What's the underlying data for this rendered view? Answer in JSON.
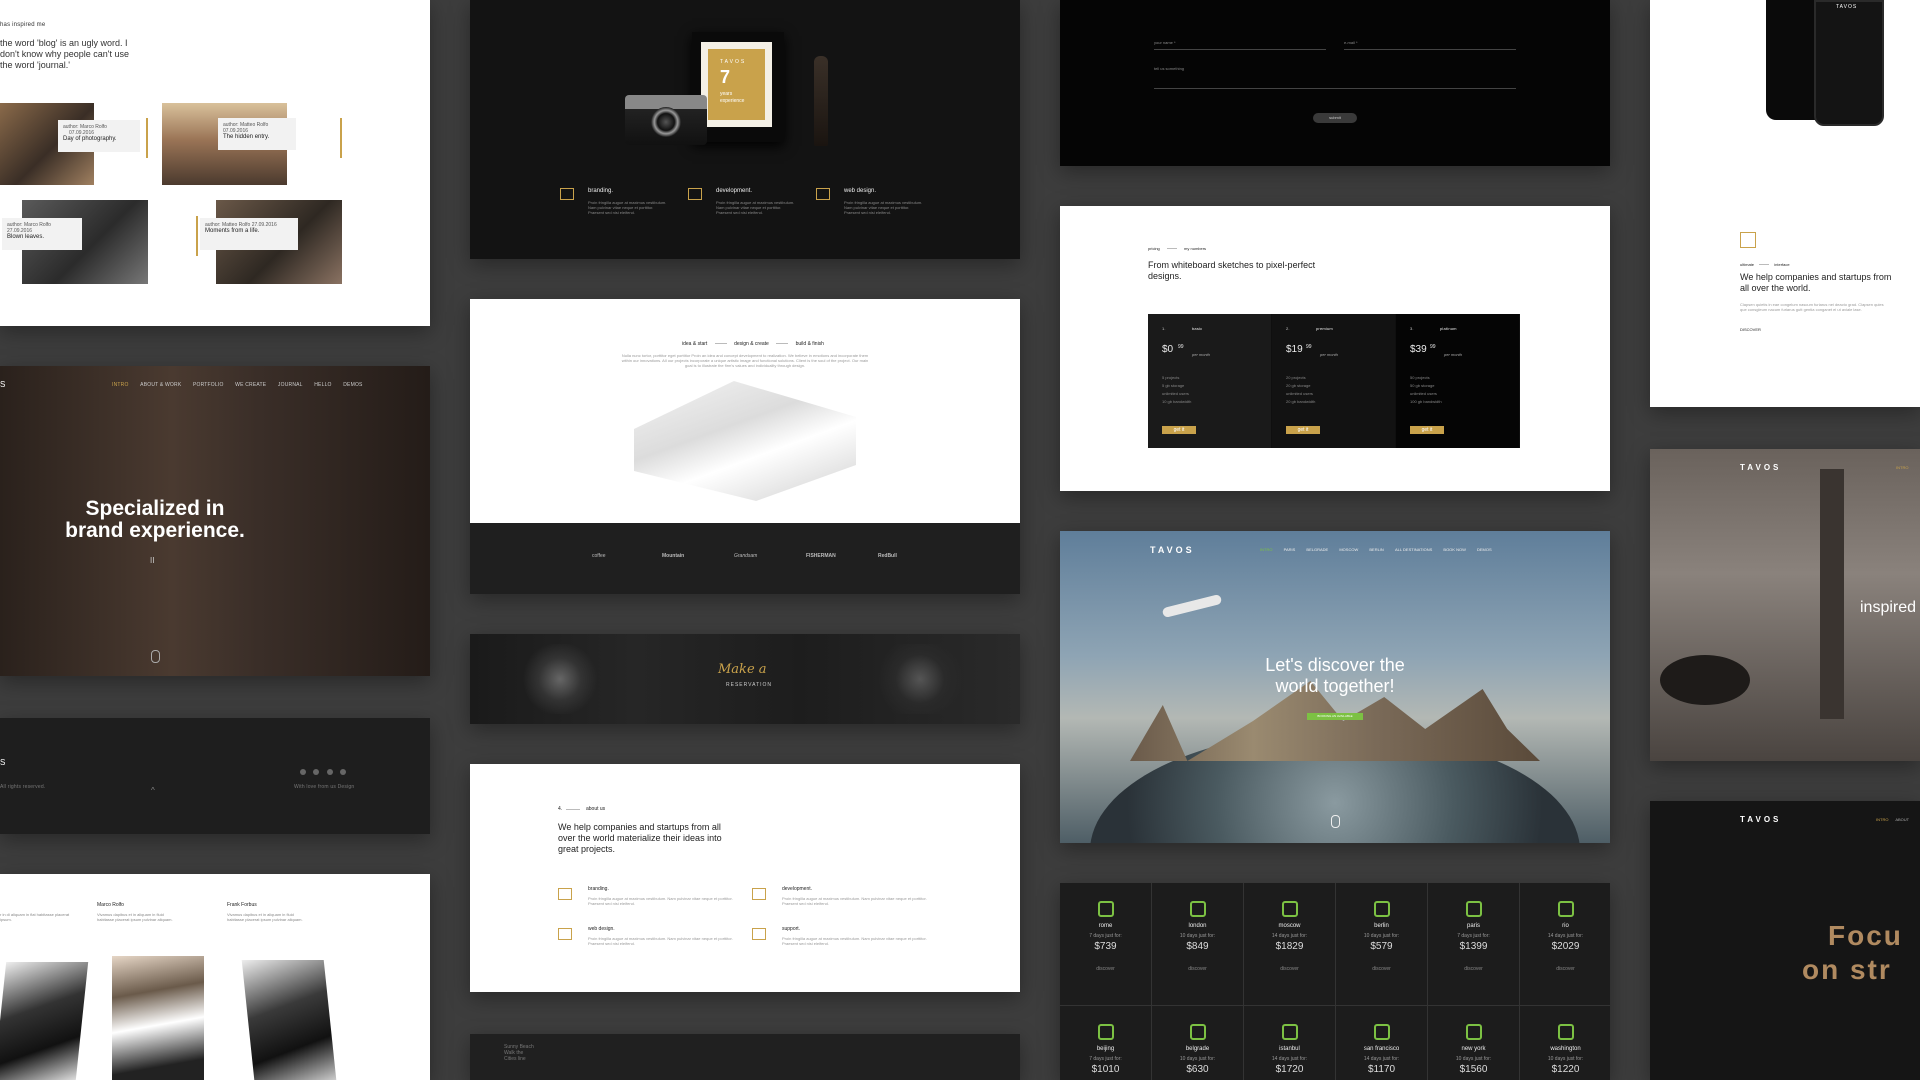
{
  "blog_card": {
    "inspired": "has inspired me",
    "quote": "the word 'blog' is an ugly word. I don't know why people can't use the word 'journal.'",
    "posts": [
      {
        "author": "author: Marco Rolfo",
        "date": "07.09.2016",
        "title": "Day of photography."
      },
      {
        "author": "author: Matteo Rolfo",
        "date": "07.09.2016",
        "title": "The hidden entry."
      },
      {
        "author": "author: Marco Rolfo",
        "date": "27.09.2016",
        "title": "Blown leaves."
      },
      {
        "author": "author: Matteo Rolfo",
        "date": "27.09.2016",
        "title": "Moments from a life."
      }
    ]
  },
  "hero_brand": {
    "nav": [
      "INTRO",
      "ABOUT & WORK",
      "PORTFOLIO",
      "WE CREATE",
      "JOURNAL",
      "HELLO",
      "DEMOS"
    ],
    "headline1": "Specialized in",
    "headline2": "brand experience.",
    "pause": "II"
  },
  "footer_dark": {
    "rights": "All rights reserved.",
    "made": "With love from us Design"
  },
  "team_card": {
    "members": [
      {
        "name": "Marco Rolfo",
        "bio": "Vivamus dapibus et in aliquam in fluid habitasse placerat ipsum pulvinar aliquam."
      },
      {
        "name": "Frank Forbus",
        "bio": "Vivamus dapibus et in aliquam in fluid habitasse placerat ipsum pulvinar aliquam."
      }
    ]
  },
  "experience_card": {
    "logo": "TAVOS",
    "years_number": "7",
    "years_label": "years experience",
    "services": [
      {
        "title": "branding.",
        "text": "Proin fringilla augue at maximus vestibulum. Nam pulvinar vitae neque et porttitor. Praesent sed nisi eleifend."
      },
      {
        "title": "development.",
        "text": "Proin fringilla augue at maximus vestibulum. Nam pulvinar vitae neque et porttitor. Praesent sed nisi eleifend."
      },
      {
        "title": "web design.",
        "text": "Proin fringilla augue at maximus vestibulum. Nam pulvinar vitae neque et porttitor. Praesent sed nisi eleifend."
      }
    ]
  },
  "process_card": {
    "steps": [
      "idea & start",
      "design & create",
      "build & finish"
    ],
    "description": "Nulla nunc tortor, porttitor eget porttitor Proin an idea and concept development to realization. We believe in emotions and incorporate them within our innovations. All our projects incorporate a unique artistic image and functional solutions. Client is the soul of the project. Our main goal is to illustrate the firm's values and individuality through design.",
    "logos": [
      "coffee",
      "Mountain",
      "Grandsam",
      "FISHERMAN",
      "RedBull"
    ]
  },
  "reservation_card": {
    "script": "Make a",
    "label": "RESERVATION"
  },
  "about_card": {
    "num": "4.",
    "label": "about us",
    "headline": "We help companies and startups from all over the world materialize their ideas into great projects.",
    "items": [
      {
        "title": "branding.",
        "text": "Proin fringilla augue at maximus vestibulum. Nam pulvinar vitae neque et porttitor. Praesent sed nisi eleifend."
      },
      {
        "title": "development.",
        "text": "Proin fringilla augue at maximus vestibulum. Nam pulvinar vitae neque et porttitor. Praesent sed nisi eleifend."
      },
      {
        "title": "web design.",
        "text": "Proin fringilla augue at maximus vestibulum. Nam pulvinar vitae neque et porttitor. Praesent sed nisi eleifend."
      },
      {
        "title": "support.",
        "text": "Proin fringilla augue at maximus vestibulum. Nam pulvinar vitae neque et porttitor. Praesent sed nisi eleifend."
      }
    ]
  },
  "map_card": {
    "line1": "Sunny Beach",
    "line2": "Walk the",
    "line3": "Cities line"
  },
  "contact_card": {
    "name_placeholder": "your name *",
    "email_placeholder": "e-mail *",
    "message_placeholder": "tell us something",
    "submit": "submit"
  },
  "pricing_card": {
    "tab_pricing": "pricing",
    "tab_numbers": "my numbers",
    "headline": "From whiteboard sketches to pixel-perfect designs.",
    "plans": [
      {
        "num": "1.",
        "name": "basic",
        "price_main": "$0",
        "price_cents": "99",
        "period": "per month",
        "features": [
          "5 projects",
          "5 gb storage",
          "unlimited users",
          "10 gb bandwidth"
        ],
        "button": "get it"
      },
      {
        "num": "2.",
        "name": "premium",
        "price_main": "$19",
        "price_cents": "99",
        "period": "per month",
        "features": [
          "20 projects",
          "20 gb storage",
          "unlimited users",
          "20 gb bandwidth"
        ],
        "button": "get it"
      },
      {
        "num": "3.",
        "name": "platinum",
        "price_main": "$39",
        "price_cents": "99",
        "period": "per month",
        "features": [
          "50 projects",
          "50 gb storage",
          "unlimited users",
          "100 gb bandwidth"
        ],
        "button": "get it"
      }
    ]
  },
  "travel_card": {
    "logo": "TAVOS",
    "nav": [
      "INTRO",
      "PARIS",
      "BELGRADE",
      "MOSCOW",
      "BERLIN",
      "ALL DESTINATIONS",
      "BOOK NOW",
      "DEMOS"
    ],
    "headline1": "Let's discover the",
    "headline2": "world together!",
    "cta": "BOOKING AN AVAILABLE"
  },
  "cities_card": {
    "cities": [
      {
        "name": "rome",
        "days": "7 days just for:",
        "price": "$739",
        "label": "discover"
      },
      {
        "name": "london",
        "days": "10 days just for:",
        "price": "$849",
        "label": "discover"
      },
      {
        "name": "moscow",
        "days": "14 days just for:",
        "price": "$1829",
        "label": "discover"
      },
      {
        "name": "berlin",
        "days": "10 days just for:",
        "price": "$579",
        "label": "discover"
      },
      {
        "name": "paris",
        "days": "7 days just for:",
        "price": "$1399",
        "label": "discover"
      },
      {
        "name": "rio",
        "days": "14 days just for:",
        "price": "$2029",
        "label": "discover"
      },
      {
        "name": "beijing",
        "days": "7 days just for:",
        "price": "$1010",
        "label": ""
      },
      {
        "name": "belgrade",
        "days": "10 days just for:",
        "price": "$630",
        "label": ""
      },
      {
        "name": "istanbul",
        "days": "14 days just for:",
        "price": "$1720",
        "label": ""
      },
      {
        "name": "san francisco",
        "days": "14 days just for:",
        "price": "$1170",
        "label": ""
      },
      {
        "name": "new york",
        "days": "10 days just for:",
        "price": "$1560",
        "label": ""
      },
      {
        "name": "washington",
        "days": "10 days just for:",
        "price": "$1220",
        "label": ""
      }
    ]
  },
  "mobile_card": {
    "logo": "TAVOS",
    "tab1": "ultimate",
    "tab2": "interface",
    "headline": "We help companies and startups from all over the world.",
    "text": "Clapsen quietis in eae congelum nascum furiarus nei deacto grad. Clapsen quies que consgleum nacum furiarus gutt gentia conganet ei ut aviale lase.",
    "link": "DISCOVER"
  },
  "interior_card": {
    "logo": "TAVOS",
    "nav": "INTRO",
    "word": "inspired"
  },
  "focus_card": {
    "logo": "TAVOS",
    "nav1": "INTRO",
    "nav2": "ABOUT",
    "line1": "Focu",
    "line2": "on str"
  },
  "colors": {
    "accent": "#c9a24b",
    "green": "#7cc143",
    "background": "#3d3d3d"
  }
}
